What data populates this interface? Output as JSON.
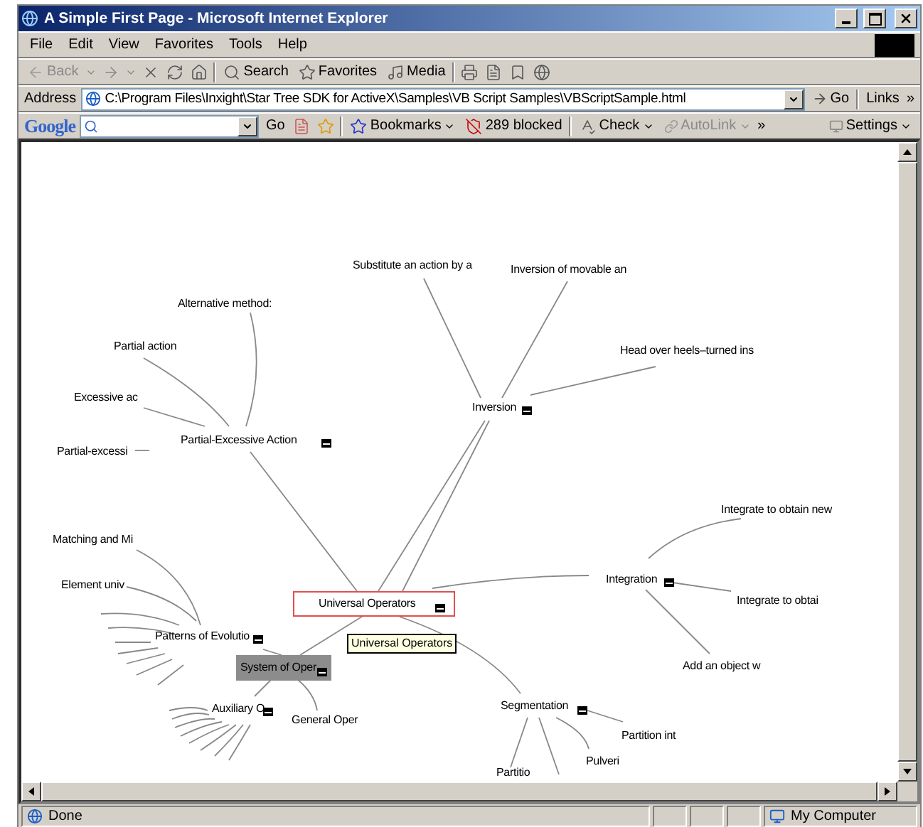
{
  "window": {
    "title": "A Simple First Page - Microsoft Internet Explorer"
  },
  "menu": [
    "File",
    "Edit",
    "View",
    "Favorites",
    "Tools",
    "Help"
  ],
  "toolbar": {
    "back": {
      "label": "Back",
      "disabled": true
    },
    "buttons": [
      "Search",
      "Favorites",
      "Media"
    ]
  },
  "address": {
    "label": "Address",
    "value": "C:\\Program Files\\Inxight\\Star Tree SDK for ActiveX\\Samples\\VB Script Samples\\VBScriptSample.html",
    "go": "Go",
    "links": "Links",
    "more": "»"
  },
  "google_bar": {
    "logo": "Google",
    "go": "Go",
    "bookmarks": "Bookmarks",
    "blocked": "289 blocked",
    "check": "Check",
    "autolink": {
      "label": "AutoLink",
      "disabled": true
    },
    "more": "»",
    "settings": "Settings"
  },
  "tree": {
    "label": "Universal Operators",
    "focused": true,
    "selected": false,
    "expanded": true,
    "children": [
      {
        "label": "Inversion",
        "focused": false,
        "selected": false,
        "expanded": true,
        "children": [
          {
            "label": "Substitute an action by a",
            "focused": false,
            "selected": false
          },
          {
            "label": "Inversion of movable an",
            "focused": false,
            "selected": false
          },
          {
            "label": "Head over heels–turned ins",
            "focused": false,
            "selected": false
          }
        ]
      },
      {
        "label": "Partial-Excessive Action",
        "focused": false,
        "selected": false,
        "expanded": true,
        "children": [
          {
            "label": "Alternative method:",
            "focused": false,
            "selected": false
          },
          {
            "label": "Partial action",
            "focused": false,
            "selected": false
          },
          {
            "label": "Excessive ac",
            "focused": false,
            "selected": false
          },
          {
            "label": "Partial-excessi",
            "focused": false,
            "selected": false
          }
        ]
      },
      {
        "label": "System of Oper",
        "focused": false,
        "selected": true,
        "expanded": true,
        "children": [
          {
            "label": "Patterns of Evolutio",
            "focused": false,
            "selected": false,
            "expanded": true,
            "children": [
              {
                "label": "Matching and Mi",
                "focused": false,
                "selected": false
              },
              {
                "label": "Element univ",
                "focused": false,
                "selected": false
              }
            ]
          },
          {
            "label": "Auxiliary O",
            "focused": false,
            "selected": false,
            "expanded": true
          },
          {
            "label": "General Oper",
            "focused": false,
            "selected": false
          }
        ]
      },
      {
        "label": "Segmentation",
        "focused": false,
        "selected": false,
        "expanded": true,
        "children": [
          {
            "label": "Partition int",
            "focused": false,
            "selected": false
          },
          {
            "label": "Pulveri",
            "focused": false,
            "selected": false
          },
          {
            "label": "Partitio",
            "focused": false,
            "selected": false
          }
        ]
      },
      {
        "label": "Integration",
        "focused": false,
        "selected": false,
        "expanded": true,
        "children": [
          {
            "label": "Integrate to obtain new",
            "focused": false,
            "selected": false
          },
          {
            "label": "Integrate to obtai",
            "focused": false,
            "selected": false
          },
          {
            "label": "Add an object w",
            "focused": false,
            "selected": false
          }
        ]
      }
    ]
  },
  "tooltip": {
    "text": "Universal Operators"
  },
  "status_bar": {
    "text": "Done",
    "zone": "My Computer"
  }
}
